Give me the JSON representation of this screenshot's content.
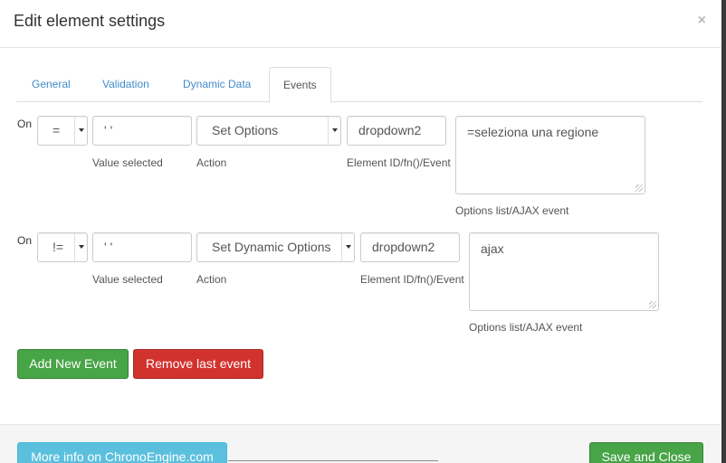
{
  "modal": {
    "title": "Edit element settings",
    "close_label": "×"
  },
  "tabs": [
    {
      "label": "General",
      "active": false
    },
    {
      "label": "Validation",
      "active": false
    },
    {
      "label": "Dynamic Data",
      "active": false
    },
    {
      "label": "Events",
      "active": true
    }
  ],
  "events": [
    {
      "on_label": "On",
      "operator": "=",
      "value": "' '",
      "value_help": "Value selected",
      "action": "Set Options",
      "action_help": "Action",
      "element_id": "dropdown2",
      "element_help": "Element ID/fn()/Event",
      "options": "=seleziona una regione",
      "options_help": "Options list/AJAX event"
    },
    {
      "on_label": "On",
      "operator": "!=",
      "value": "' '",
      "value_help": "Value selected",
      "action": "Set Dynamic Options",
      "action_help": "Action",
      "element_id": "dropdown2",
      "element_help": "Element ID/fn()/Event",
      "options": "ajax",
      "options_help": "Options list/AJAX event"
    }
  ],
  "buttons": {
    "add_event": "Add New Event",
    "remove_event": "Remove last event",
    "more_info": "More info on ChronoEngine.com",
    "save_close": "Save and Close"
  },
  "colors": {
    "link": "#428bca",
    "success": "#47a447",
    "danger": "#d2322d",
    "info": "#5bc0de"
  }
}
